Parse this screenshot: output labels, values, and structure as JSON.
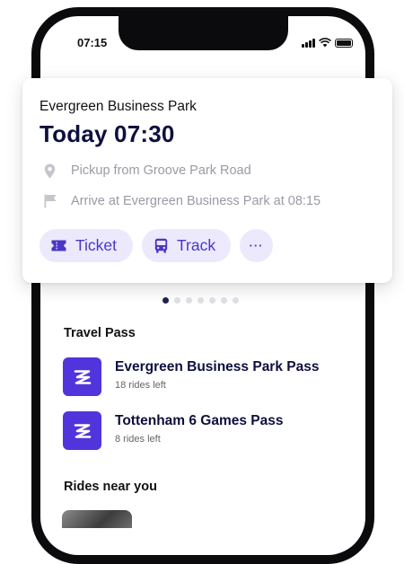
{
  "status_bar": {
    "time": "07:15",
    "icons": [
      "signal-icon",
      "wifi-icon",
      "battery-icon"
    ]
  },
  "trip_card": {
    "destination": "Evergreen Business Park",
    "departure": "Today 07:30",
    "pickup": {
      "icon": "location-pin-icon",
      "text": "Pickup from Groove Park Road"
    },
    "arrive": {
      "icon": "flag-icon",
      "text": "Arrive at Evergreen Business Park at 08:15"
    },
    "actions": {
      "ticket_label": "Ticket",
      "ticket_icon": "ticket-icon",
      "track_label": "Track",
      "track_icon": "bus-icon",
      "more_label": "···"
    }
  },
  "pagination": {
    "total": 7,
    "active": 1
  },
  "travel_pass": {
    "title": "Travel Pass",
    "items": [
      {
        "name": "Evergreen Business Park Pass",
        "rides": "18 rides left"
      },
      {
        "name": "Tottenham 6 Games Pass",
        "rides": "8 rides left"
      }
    ]
  },
  "rides_near_you": {
    "title": "Rides near you"
  },
  "colors": {
    "accent": "#5134db",
    "chip_bg": "#ece9fd",
    "chip_text": "#4a37c6",
    "heading": "#0e0f3d",
    "muted": "#9a9aa6"
  }
}
